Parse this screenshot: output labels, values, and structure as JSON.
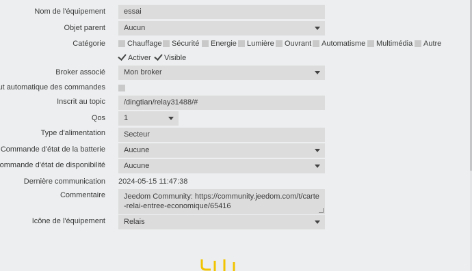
{
  "form": {
    "name": {
      "label": "Nom de l'équipement",
      "value": "essai"
    },
    "parent": {
      "label": "Objet parent",
      "value": "Aucun"
    },
    "category": {
      "label": "Catégorie",
      "options": [
        "Chauffage",
        "Sécurité",
        "Energie",
        "Lumière",
        "Ouvrant",
        "Automatisme",
        "Multimédia",
        "Autre"
      ]
    },
    "activate": {
      "label": "Activer",
      "checked": true
    },
    "visible": {
      "label": "Visible",
      "checked": true
    },
    "broker": {
      "label": "Broker associé",
      "value": "Mon broker"
    },
    "auto_add": {
      "label": "Ajout automatique des commandes",
      "checked": false
    },
    "topic": {
      "label": "Inscrit au topic",
      "value": "/dingtian/relay31488/#"
    },
    "qos": {
      "label": "Qos",
      "value": "1"
    },
    "power": {
      "label": "Type d'alimentation",
      "value": "Secteur"
    },
    "battery_cmd": {
      "label": "Commande d'état de la batterie",
      "value": "Aucune"
    },
    "availability_cmd": {
      "label": "Commande d'état de disponibilité",
      "value": "Aucune"
    },
    "last_comm": {
      "label": "Dernière communication",
      "value": "2024-05-15 11:47:38"
    },
    "comment": {
      "label": "Commentaire",
      "value": "Jeedom Community: https://community.jeedom.com/t/carte-relai-entree-economique/65416"
    },
    "icon": {
      "label": "Icône de l'équipement",
      "value": "Relais"
    }
  },
  "colors": {
    "background": "#eceeef",
    "field": "#dcdcdc",
    "logo": "#f2c400"
  },
  "icons": {
    "logo": "relay-logo-icon"
  }
}
